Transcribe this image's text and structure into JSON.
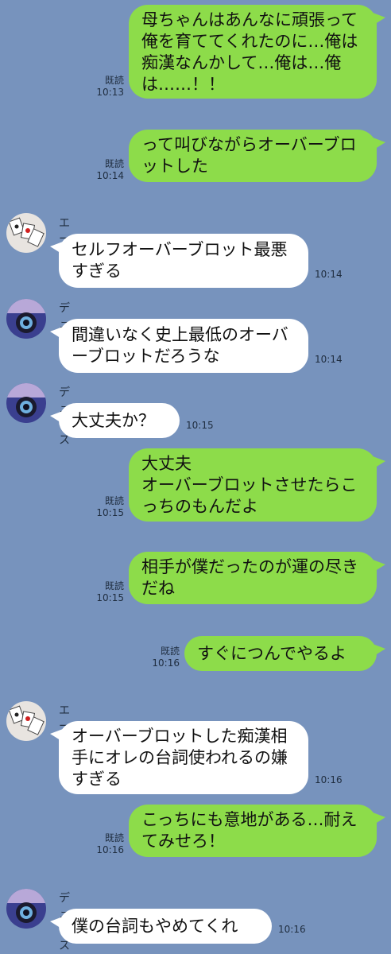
{
  "read_label": "既読",
  "messages": [
    {
      "text": "母ちゃんはあんなに頑張って俺を育ててくれたのに…俺は痴漢なんかして…俺は…俺は……！！",
      "time": "10:13"
    },
    {
      "text": "って叫びながらオーバーブロットした",
      "time": "10:14"
    },
    {
      "sender": "エース",
      "text": "セルフオーバーブロット最悪すぎる",
      "time": "10:14"
    },
    {
      "sender": "デュース",
      "text": "間違いなく史上最低のオーバーブロットだろうな",
      "time": "10:14"
    },
    {
      "sender": "デュース",
      "text": "大丈夫か？",
      "time": "10:15"
    },
    {
      "text": "大丈夫\nオーバーブロットさせたらこっちのもんだよ",
      "time": "10:15"
    },
    {
      "text": "相手が僕だったのが運の尽きだね",
      "time": "10:15"
    },
    {
      "text": "すぐにつんでやるよ",
      "time": "10:16"
    },
    {
      "sender": "エース",
      "text": "オーバーブロットした痴漢相手にオレの台詞使われるの嫌すぎる",
      "time": "10:16"
    },
    {
      "text": "こっちにも意地がある…耐えてみせろ！",
      "time": "10:16"
    },
    {
      "sender": "デュース",
      "text": "僕の台詞もやめてくれ",
      "time": "10:16"
    }
  ]
}
